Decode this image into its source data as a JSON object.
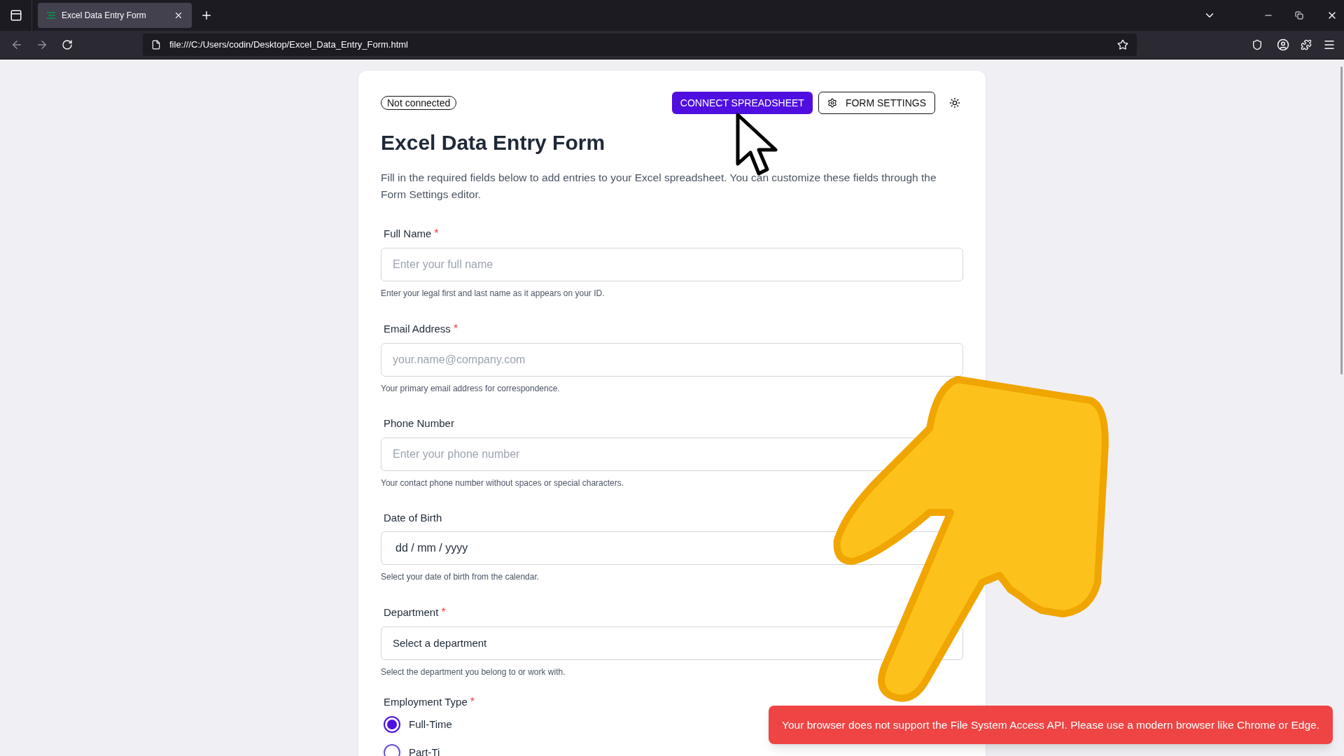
{
  "browser": {
    "tabs": [
      {
        "title": "Excel Data Entry Form",
        "selected": true
      }
    ],
    "url": "file:///C:/Users/codin/Desktop/Excel_Data_Entry_Form.html"
  },
  "header": {
    "status": "Not connected",
    "connect_button": "CONNECT SPREADSHEET",
    "settings_button": "FORM SETTINGS"
  },
  "form": {
    "title": "Excel Data Entry Form",
    "description": "Fill in the required fields below to add entries to your Excel spreadsheet. You can customize these fields through the Form Settings editor.",
    "fields": [
      {
        "kind": "text",
        "label": "Full Name",
        "required": true,
        "placeholder": "Enter your full name",
        "helper": "Enter your legal first and last name as it appears on your ID."
      },
      {
        "kind": "text",
        "label": "Email Address",
        "required": true,
        "placeholder": "your.name@company.com",
        "helper": "Your primary email address for correspondence."
      },
      {
        "kind": "text",
        "label": "Phone Number",
        "required": false,
        "placeholder": "Enter your phone number",
        "helper": "Your contact phone number without spaces or special characters."
      },
      {
        "kind": "date",
        "label": "Date of Birth",
        "required": false,
        "value": "dd / mm / yyyy",
        "helper": "Select your date of birth from the calendar."
      },
      {
        "kind": "select",
        "label": "Department",
        "required": true,
        "value": "Select a department",
        "helper": "Select the department you belong to or work with."
      },
      {
        "kind": "radio",
        "label": "Employment Type",
        "required": true,
        "options": [
          {
            "label": "Full-Time",
            "selected": true
          },
          {
            "label": "Part-Ti",
            "selected": false
          }
        ]
      }
    ]
  },
  "required_mark": "*",
  "toast": {
    "message": "Your browser does not support the File System Access API. Please use a modern browser like Chrome or Edge."
  }
}
